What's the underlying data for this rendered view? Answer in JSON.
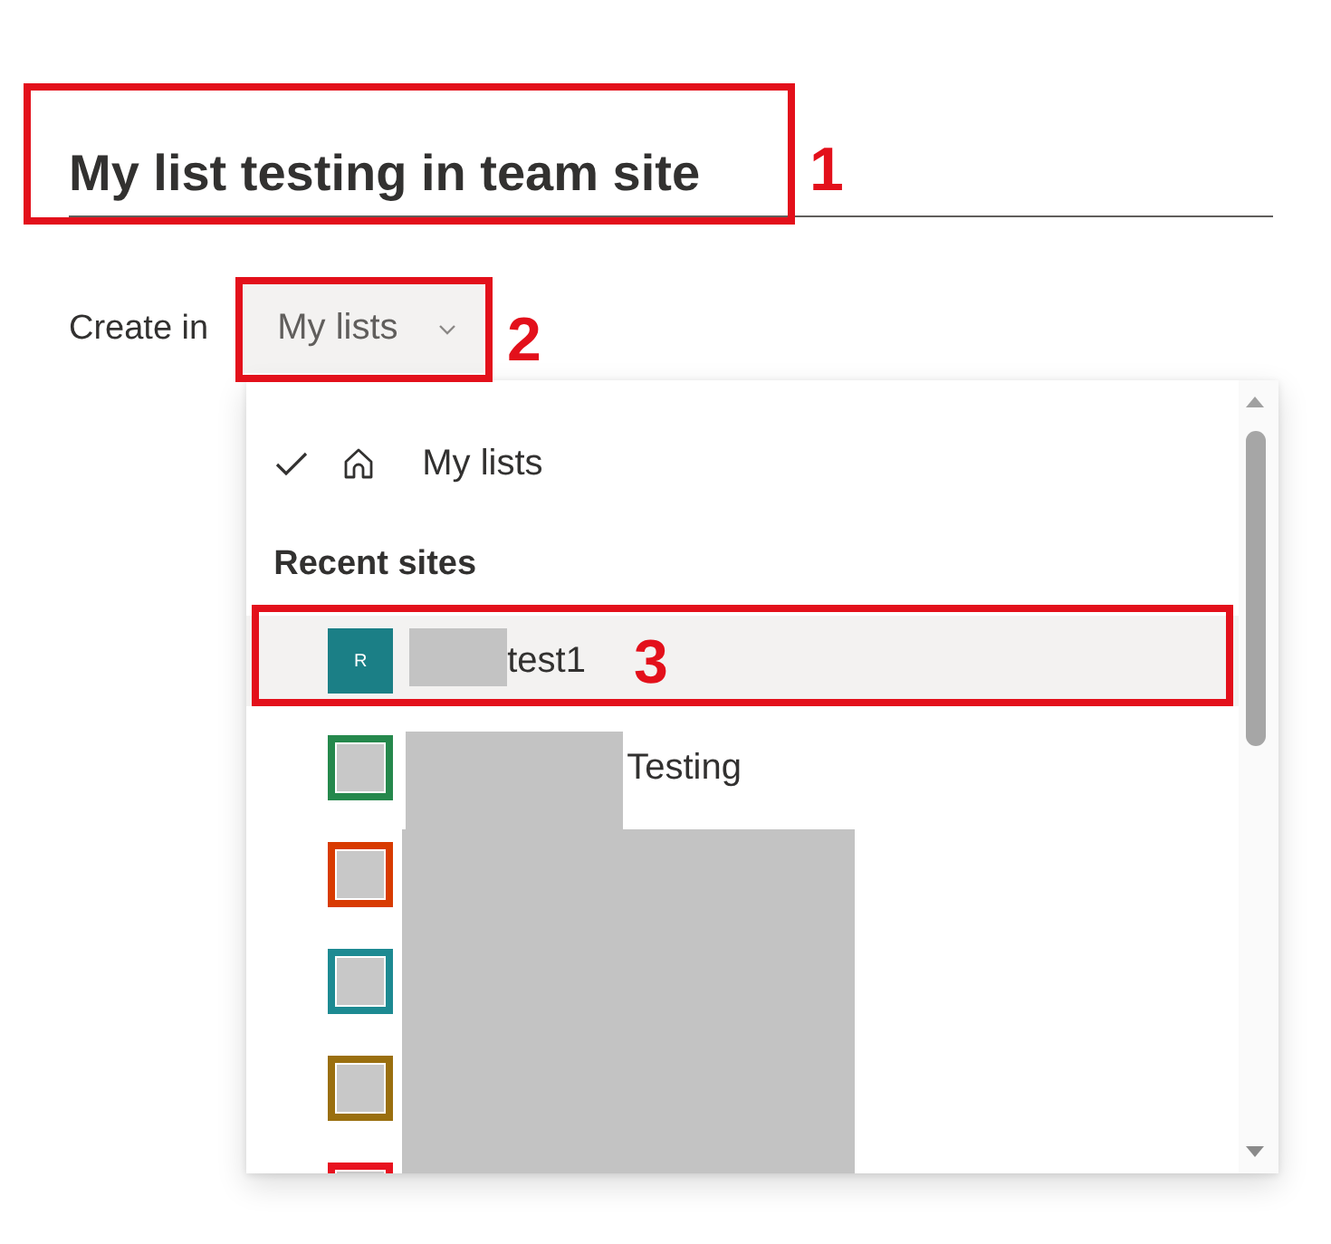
{
  "title_field": {
    "value": "My list testing in team site"
  },
  "create_in": {
    "label": "Create in",
    "dropdown": {
      "value": "My lists",
      "expanded": true
    }
  },
  "menu": {
    "options": [
      {
        "label": "My lists",
        "selected": true
      }
    ],
    "section_title": "Recent sites",
    "sites": [
      {
        "kind": "initial",
        "initial": "R",
        "label": "test1",
        "color": "#1b7f86",
        "highlighted": true
      },
      {
        "kind": "thumbnail",
        "label": "Testing",
        "color": "#25884c",
        "highlighted": false
      },
      {
        "kind": "thumbnail",
        "color": "#d83b01",
        "highlighted": false
      },
      {
        "kind": "thumbnail",
        "color": "#1d8a92",
        "highlighted": false
      },
      {
        "kind": "thumbnail",
        "color": "#9a6f0f",
        "highlighted": false
      },
      {
        "kind": "thumbnail",
        "color": "#e8111f",
        "highlighted": false
      }
    ]
  },
  "annotations": [
    {
      "label": "1"
    },
    {
      "label": "2"
    },
    {
      "label": "3"
    }
  ]
}
